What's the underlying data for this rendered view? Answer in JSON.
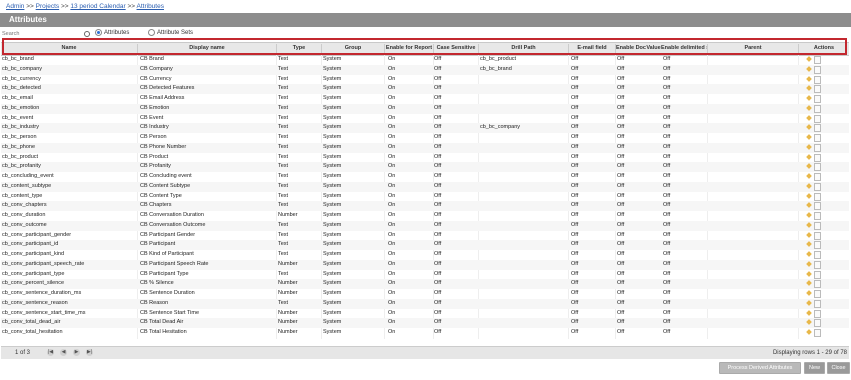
{
  "breadcrumb": {
    "admin": "Admin",
    "sep1": ">>",
    "projects": "Projects",
    "sep2": ">>",
    "project": "13 period Calendar",
    "sep3": ">>",
    "current": "Attributes"
  },
  "page": {
    "title": "Attributes"
  },
  "filter": {
    "search_placeholder": "Search",
    "radio_attributes": "Attributes",
    "radio_attribute_sets": "Attribute Sets",
    "selected": "Attributes"
  },
  "columns": [
    "Name",
    "Display name",
    "Type",
    "Group",
    "Enable for Report",
    "Case Sensitive",
    "Drill Path",
    "E-mail field",
    "Enable Doc",
    "Value",
    "Enable delimited s",
    "Parent",
    "Actions"
  ],
  "rows": [
    {
      "name": "cb_bc_brand",
      "display": "CB Brand",
      "type": "Text",
      "group": "System",
      "report": "On",
      "case": "Off",
      "drill": "cb_bc_product",
      "email": "Off",
      "doc": "Off",
      "delim": "Off"
    },
    {
      "name": "cb_bc_company",
      "display": "CB Company",
      "type": "Text",
      "group": "System",
      "report": "On",
      "case": "Off",
      "drill": "cb_bc_brand",
      "email": "Off",
      "doc": "Off",
      "delim": "Off"
    },
    {
      "name": "cb_bc_currency",
      "display": "CB Currency",
      "type": "Text",
      "group": "System",
      "report": "On",
      "case": "Off",
      "drill": "",
      "email": "Off",
      "doc": "Off",
      "delim": "Off"
    },
    {
      "name": "cb_bc_detected",
      "display": "CB Detected Features",
      "type": "Text",
      "group": "System",
      "report": "On",
      "case": "Off",
      "drill": "",
      "email": "Off",
      "doc": "Off",
      "delim": "Off"
    },
    {
      "name": "cb_bc_email",
      "display": "CB Email Address",
      "type": "Text",
      "group": "System",
      "report": "On",
      "case": "Off",
      "drill": "",
      "email": "Off",
      "doc": "Off",
      "delim": "Off"
    },
    {
      "name": "cb_bc_emotion",
      "display": "CB Emotion",
      "type": "Text",
      "group": "System",
      "report": "On",
      "case": "Off",
      "drill": "",
      "email": "Off",
      "doc": "Off",
      "delim": "Off"
    },
    {
      "name": "cb_bc_event",
      "display": "CB Event",
      "type": "Text",
      "group": "System",
      "report": "On",
      "case": "Off",
      "drill": "",
      "email": "Off",
      "doc": "Off",
      "delim": "Off"
    },
    {
      "name": "cb_bc_industry",
      "display": "CB Industry",
      "type": "Text",
      "group": "System",
      "report": "On",
      "case": "Off",
      "drill": "cb_bc_company",
      "email": "Off",
      "doc": "Off",
      "delim": "Off"
    },
    {
      "name": "cb_bc_person",
      "display": "CB Person",
      "type": "Text",
      "group": "System",
      "report": "On",
      "case": "Off",
      "drill": "",
      "email": "Off",
      "doc": "Off",
      "delim": "Off"
    },
    {
      "name": "cb_bc_phone",
      "display": "CB Phone Number",
      "type": "Text",
      "group": "System",
      "report": "On",
      "case": "Off",
      "drill": "",
      "email": "Off",
      "doc": "Off",
      "delim": "Off"
    },
    {
      "name": "cb_bc_product",
      "display": "CB Product",
      "type": "Text",
      "group": "System",
      "report": "On",
      "case": "Off",
      "drill": "",
      "email": "Off",
      "doc": "Off",
      "delim": "Off"
    },
    {
      "name": "cb_bc_profanity",
      "display": "CB Profanity",
      "type": "Text",
      "group": "System",
      "report": "On",
      "case": "Off",
      "drill": "",
      "email": "Off",
      "doc": "Off",
      "delim": "Off"
    },
    {
      "name": "cb_concluding_event",
      "display": "CB Concluding event",
      "type": "Text",
      "group": "System",
      "report": "On",
      "case": "Off",
      "drill": "",
      "email": "Off",
      "doc": "Off",
      "delim": "Off"
    },
    {
      "name": "cb_content_subtype",
      "display": "CB Content Subtype",
      "type": "Text",
      "group": "System",
      "report": "On",
      "case": "Off",
      "drill": "",
      "email": "Off",
      "doc": "Off",
      "delim": "Off"
    },
    {
      "name": "cb_content_type",
      "display": "CB Content Type",
      "type": "Text",
      "group": "System",
      "report": "On",
      "case": "Off",
      "drill": "",
      "email": "Off",
      "doc": "Off",
      "delim": "Off"
    },
    {
      "name": "cb_conv_chapters",
      "display": "CB Chapters",
      "type": "Text",
      "group": "System",
      "report": "On",
      "case": "Off",
      "drill": "",
      "email": "Off",
      "doc": "Off",
      "delim": "Off"
    },
    {
      "name": "cb_conv_duration",
      "display": "CB Conversation Duration",
      "type": "Number",
      "group": "System",
      "report": "On",
      "case": "Off",
      "drill": "",
      "email": "Off",
      "doc": "Off",
      "delim": "Off"
    },
    {
      "name": "cb_conv_outcome",
      "display": "CB Conversation Outcome",
      "type": "Text",
      "group": "System",
      "report": "On",
      "case": "Off",
      "drill": "",
      "email": "Off",
      "doc": "Off",
      "delim": "Off"
    },
    {
      "name": "cb_conv_participant_gender",
      "display": "CB Participant Gender",
      "type": "Text",
      "group": "System",
      "report": "On",
      "case": "Off",
      "drill": "",
      "email": "Off",
      "doc": "Off",
      "delim": "Off"
    },
    {
      "name": "cb_conv_participant_id",
      "display": "CB Participant",
      "type": "Text",
      "group": "System",
      "report": "On",
      "case": "Off",
      "drill": "",
      "email": "Off",
      "doc": "Off",
      "delim": "Off"
    },
    {
      "name": "cb_conv_participant_kind",
      "display": "CB Kind of Participant",
      "type": "Text",
      "group": "System",
      "report": "On",
      "case": "Off",
      "drill": "",
      "email": "Off",
      "doc": "Off",
      "delim": "Off"
    },
    {
      "name": "cb_conv_participant_speech_rate",
      "display": "CB Participant Speech Rate",
      "type": "Number",
      "group": "System",
      "report": "On",
      "case": "Off",
      "drill": "",
      "email": "Off",
      "doc": "Off",
      "delim": "Off"
    },
    {
      "name": "cb_conv_participant_type",
      "display": "CB Participant Type",
      "type": "Text",
      "group": "System",
      "report": "On",
      "case": "Off",
      "drill": "",
      "email": "Off",
      "doc": "Off",
      "delim": "Off"
    },
    {
      "name": "cb_conv_percent_silence",
      "display": "CB % Silence",
      "type": "Number",
      "group": "System",
      "report": "On",
      "case": "Off",
      "drill": "",
      "email": "Off",
      "doc": "Off",
      "delim": "Off"
    },
    {
      "name": "cb_conv_sentence_duration_ms",
      "display": "CB Sentence Duration",
      "type": "Number",
      "group": "System",
      "report": "On",
      "case": "Off",
      "drill": "",
      "email": "Off",
      "doc": "Off",
      "delim": "Off"
    },
    {
      "name": "cb_conv_sentence_reason",
      "display": "CB Reason",
      "type": "Text",
      "group": "System",
      "report": "On",
      "case": "Off",
      "drill": "",
      "email": "Off",
      "doc": "Off",
      "delim": "Off"
    },
    {
      "name": "cb_conv_sentence_start_time_ms",
      "display": "CB Sentence Start Time",
      "type": "Number",
      "group": "System",
      "report": "On",
      "case": "Off",
      "drill": "",
      "email": "Off",
      "doc": "Off",
      "delim": "Off"
    },
    {
      "name": "cb_conv_total_dead_air",
      "display": "CB Total Dead Air",
      "type": "Number",
      "group": "System",
      "report": "On",
      "case": "Off",
      "drill": "",
      "email": "Off",
      "doc": "Off",
      "delim": "Off"
    },
    {
      "name": "cb_conv_total_hesitation",
      "display": "CB Total Hesitation",
      "type": "Number",
      "group": "System",
      "report": "On",
      "case": "Off",
      "drill": "",
      "email": "Off",
      "doc": "Off",
      "delim": "Off"
    }
  ],
  "pager": {
    "page_info": "1 of 3",
    "first": "|◀",
    "prev": "◀",
    "next": "▶",
    "last": "▶|",
    "display": "Displaying rows 1 - 29 of 78"
  },
  "buttons": {
    "process": "Process Derived Attributes",
    "new": "New",
    "close": "Close"
  },
  "colors": {
    "title_bar": "#8d8d8d",
    "highlight": "#c3282f",
    "link": "#2a5db0"
  }
}
